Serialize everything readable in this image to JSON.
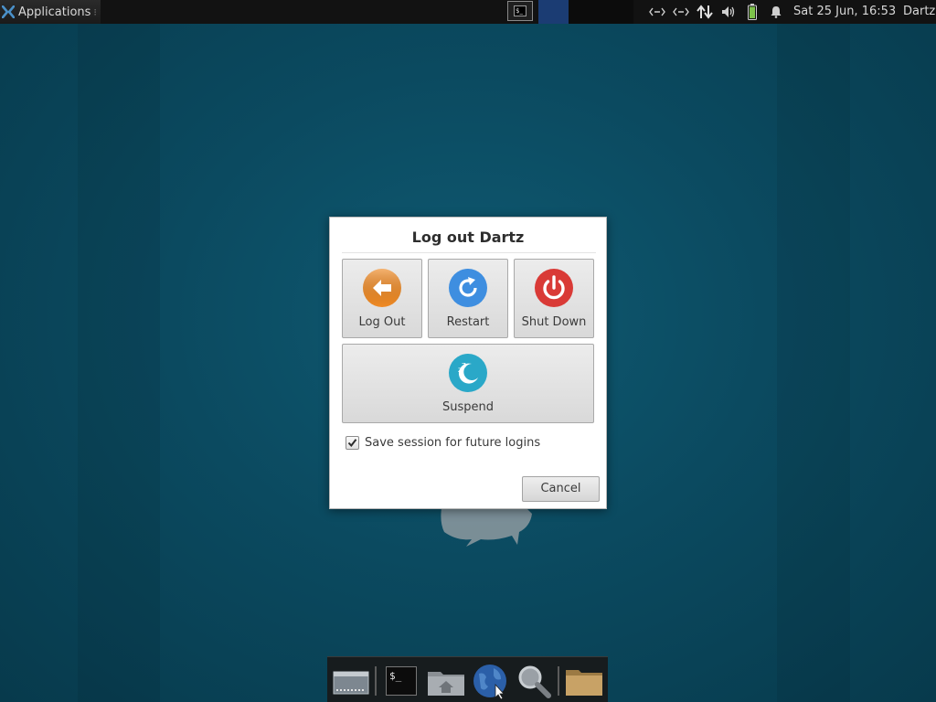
{
  "top_panel": {
    "applications_label": "Applications",
    "separator_glyph": "⁝",
    "clock": "Sat 25 Jun, 16:53",
    "user": "Dartz",
    "tray_icons": [
      "network-icon",
      "network-icon-2",
      "transfer-icon",
      "volume-icon",
      "battery-icon",
      "notification-bell-icon"
    ],
    "task_terminal_glyph": "$_"
  },
  "dialog": {
    "title": "Log out Dartz",
    "buttons": {
      "logout": "Log Out",
      "restart": "Restart",
      "shutdown": "Shut Down",
      "suspend": "Suspend"
    },
    "save_session_label": "Save session for future logins",
    "save_session_checked": true,
    "cancel_label": "Cancel",
    "colors": {
      "logout": "#f08a24",
      "restart": "#3e8ee0",
      "shutdown": "#d93a36",
      "suspend": "#2aa8c8"
    }
  },
  "dock": {
    "items": [
      "workspace-icon",
      "terminal-icon",
      "home-folder-icon",
      "web-browser-icon",
      "search-icon",
      "folder-icon"
    ],
    "terminal_glyph": "$_"
  }
}
